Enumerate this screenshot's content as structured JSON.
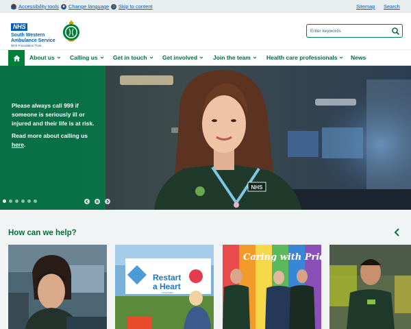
{
  "utility": {
    "accessibility": "Accessibility tools",
    "language": "Change language",
    "skip": "Skip to content",
    "sitemap": "Sitemap",
    "search": "Search"
  },
  "header": {
    "nhs_badge": "NHS",
    "org_name_line1": "South Western",
    "org_name_line2": "Ambulance Service",
    "org_sub": "NHS Foundation Trust",
    "search_placeholder": "Enter keywords"
  },
  "nav": {
    "items": [
      {
        "label": "About us",
        "dropdown": true
      },
      {
        "label": "Calling us",
        "dropdown": true
      },
      {
        "label": "Get in touch",
        "dropdown": true
      },
      {
        "label": "Get involved",
        "dropdown": true
      },
      {
        "label": "Join the team",
        "dropdown": true
      },
      {
        "label": "Health care professionals",
        "dropdown": true
      },
      {
        "label": "News",
        "dropdown": false
      }
    ]
  },
  "hero": {
    "message": "Please always call 999 if someone is seriously ill or injured and their life is at risk.",
    "link_prefix": "Read more about calling us ",
    "link_text": "here",
    "link_suffix": ".",
    "slide_count": 6,
    "active_slide": 1,
    "uniform_text": "NHS"
  },
  "help": {
    "title": "How can we help?",
    "cards": [
      {
        "name": "call-handler-card"
      },
      {
        "name": "restart-a-heart-card",
        "sign_line1": "Restart",
        "sign_line2": "a Heart",
        "sign_small": "TOGETHER"
      },
      {
        "name": "pride-card",
        "mural_text": "Caring with Pride"
      },
      {
        "name": "paramedic-card"
      }
    ]
  },
  "colors": {
    "nhs_blue": "#005eb8",
    "nhs_green": "#007f3b",
    "nav_text": "#00703c",
    "utility_bg": "#e8edee",
    "section_bg": "#f0f4f5"
  }
}
